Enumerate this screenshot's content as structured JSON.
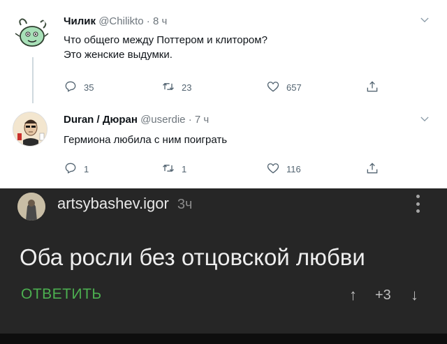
{
  "tweets": [
    {
      "name": "Чилик",
      "handle": "@Chilikto",
      "sep": "·",
      "time": "8 ч",
      "lines": [
        "Что общего между Поттером и клитором?",
        "Это женские выдумки."
      ],
      "replies": "35",
      "retweets": "23",
      "likes": "657"
    },
    {
      "name": "Duran / Дюран",
      "handle": "@userdie",
      "sep": "·",
      "time": "7 ч",
      "lines": [
        "Гермиона любила с ним поиграть"
      ],
      "replies": "1",
      "retweets": "1",
      "likes": "116"
    }
  ],
  "comment": {
    "username": "artsybashev.igor",
    "time": "3ч",
    "text": "Оба росли без отцовской любви",
    "reply_label": "ОТВЕТИТЬ",
    "up_arrow": "↑",
    "score": "+3",
    "down_arrow": "↓"
  },
  "icons": {
    "chevron": "chevron-down-icon",
    "reply": "reply-icon",
    "retweet": "retweet-icon",
    "like": "heart-icon",
    "share": "share-icon",
    "more": "more-vertical-icon"
  },
  "colors": {
    "reply_green": "#4caf50",
    "dark_bg": "#262626",
    "twitter_gray": "#536471"
  }
}
